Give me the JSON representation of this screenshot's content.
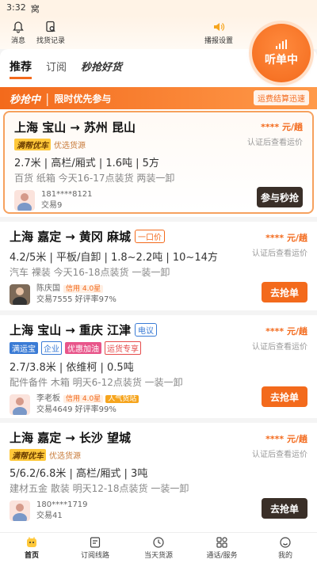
{
  "statusbar": {
    "time": "3:32",
    "extra": "窝"
  },
  "topbar": {
    "messages_label": "消息",
    "records_label": "找货记录",
    "broadcast_label": "播报设置",
    "listen_label": "听单中"
  },
  "tabs": [
    {
      "label": "推荐"
    },
    {
      "label": "订阅"
    },
    {
      "label": "秒抢好货"
    }
  ],
  "banner": {
    "brand": "秒抢中",
    "title": "限时优先参与",
    "badge": "运费结算迅速"
  },
  "cards": [
    {
      "from": "上海 宝山",
      "arrow": "→",
      "to": "苏州 昆山",
      "tags": [
        "满帮优车",
        "优选货源"
      ],
      "spec": "2.7米 | 高栏/厢式 | 1.6吨 | 5方",
      "detail": "百货 纸箱 今天16-17点装货 两装一卸",
      "user_name": "181****8121",
      "user_sub": "交易9",
      "price": "**** 元/趟",
      "note": "认证后查看运价",
      "button": "参与秒抢"
    },
    {
      "from": "上海 嘉定",
      "arrow": "→",
      "to": "黄冈 麻城",
      "route_tag": "一口价",
      "spec": "4.2/5米 | 平板/自卸 | 1.8~2.2吨 | 10~14方",
      "detail": "汽车 裸装 今天16-18点装货 一装一卸",
      "user_name": "陈庆国",
      "user_credit": "信用 4.0星",
      "user_sub": "交易7555 好评率97%",
      "price": "**** 元/趟",
      "note": "认证后查看运价",
      "button": "去抢单"
    },
    {
      "from": "上海 宝山",
      "arrow": "→",
      "to": "重庆 江津",
      "route_tag": "电议",
      "tags": [
        "满运宝",
        "企业",
        "优惠加油",
        "运货专享"
      ],
      "spec": "2.7/3.8米 | 依维柯 | 0.5吨",
      "detail": "配件备件 木箱 明天6-12点装货 一装一卸",
      "user_name": "李老板",
      "user_credit": "信用 4.0星",
      "user_badge": "人气货站",
      "user_sub": "交易4649 好评率99%",
      "price": "**** 元/趟",
      "note": "认证后查看运价",
      "button": "去抢单"
    },
    {
      "from": "上海 嘉定",
      "arrow": "→",
      "to": "长沙 望城",
      "tags": [
        "满帮优车",
        "优选货源"
      ],
      "spec": "5/6.2/6.8米 | 高栏/厢式 | 3吨",
      "detail": "建材五金 散装 明天12-18点装货 一装一卸",
      "user_name": "180****1719",
      "user_sub": "交易41",
      "price": "**** 元/趟",
      "note": "认证后查看运价",
      "button": "去抢单"
    }
  ],
  "bottomnav": [
    {
      "label": "首页"
    },
    {
      "label": "订阅线路"
    },
    {
      "label": "当天货源"
    },
    {
      "label": "通话/服务"
    },
    {
      "label": "我的"
    }
  ],
  "colors": {
    "accent": "#f36a1c",
    "dark_button": "#3a2f28"
  }
}
